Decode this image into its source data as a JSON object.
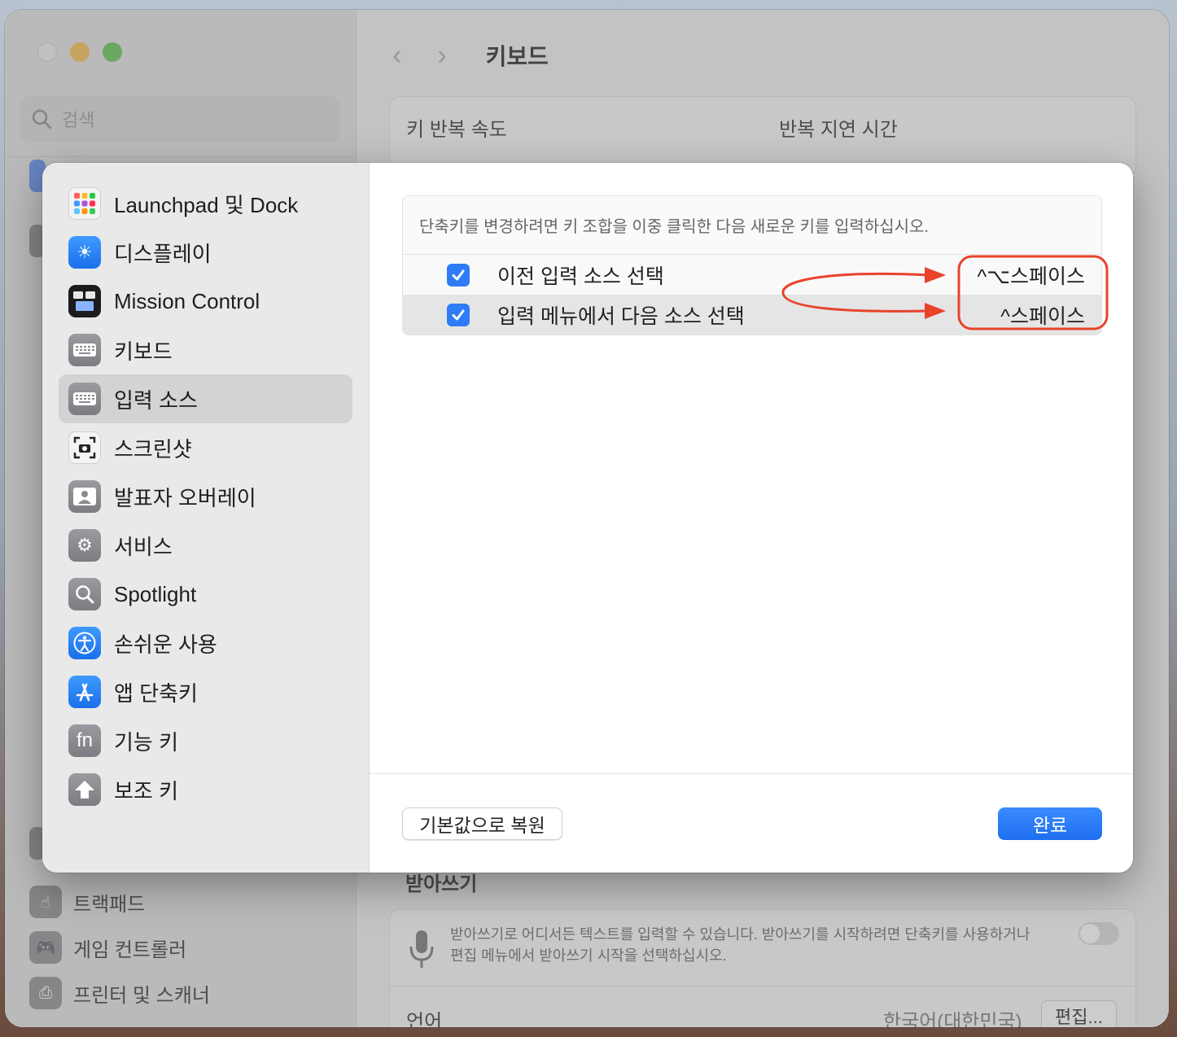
{
  "background_window": {
    "search_placeholder": "검색",
    "nav_title": "키보드",
    "nav_back_glyph": "‹",
    "nav_forward_glyph": "›",
    "key_repeat_label": "키 반복 속도",
    "repeat_delay_label": "반복 지연 시간",
    "dictation_heading": "받아쓰기",
    "dictation_desc_line1": "받아쓰기로 어디서든 텍스트를 입력할 수 있습니다. 받아쓰기를 시작하려면 단축키를 사용하거나",
    "dictation_desc_line2": "편집 메뉴에서 받아쓰기 시작을 선택하십시오.",
    "language_label": "언어",
    "language_value": "한국어(대한민국)",
    "edit_button": "편집...",
    "sidebar_items": [
      {
        "label": "트랙패드",
        "icon": "trackpad-icon"
      },
      {
        "label": "게임 컨트롤러",
        "icon": "gamepad-icon"
      },
      {
        "label": "프린터 및 스캐너",
        "icon": "printer-icon"
      }
    ]
  },
  "dialog": {
    "categories": [
      {
        "label": "Launchpad 및 Dock",
        "icon": "launchpad-icon"
      },
      {
        "label": "디스플레이",
        "icon": "display-brightness-icon"
      },
      {
        "label": "Mission Control",
        "icon": "mission-control-icon"
      },
      {
        "label": "키보드",
        "icon": "keyboard-icon"
      },
      {
        "label": "입력 소스",
        "icon": "input-source-icon"
      },
      {
        "label": "스크린샷",
        "icon": "screenshot-icon"
      },
      {
        "label": "발표자 오버레이",
        "icon": "presenter-overlay-icon"
      },
      {
        "label": "서비스",
        "icon": "services-gear-icon"
      },
      {
        "label": "Spotlight",
        "icon": "spotlight-search-icon"
      },
      {
        "label": "손쉬운 사용",
        "icon": "accessibility-icon"
      },
      {
        "label": "앱 단축키",
        "icon": "app-shortcuts-icon"
      },
      {
        "label": "기능 키",
        "icon": "fn-key-icon"
      },
      {
        "label": "보조 키",
        "icon": "modifier-key-icon"
      }
    ],
    "selected_category": "입력 소스",
    "hint": "단축키를 변경하려면 키 조합을 이중 클릭한 다음 새로운 키를 입력하십시오.",
    "shortcuts": [
      {
        "label": "이전 입력 소스 선택",
        "keys": "^⌥스페이스",
        "checked": true
      },
      {
        "label": "입력 메뉴에서 다음 소스 선택",
        "keys": "^스페이스",
        "checked": true
      }
    ],
    "restore_button": "기본값으로 복원",
    "done_button": "완료"
  },
  "colors": {
    "accent": "#2f7cf6",
    "annotation": "#e8432b"
  }
}
